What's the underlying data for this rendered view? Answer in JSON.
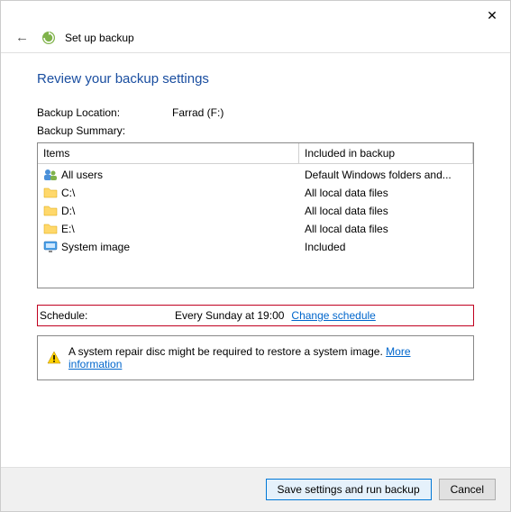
{
  "window": {
    "title": "Set up backup"
  },
  "heading": "Review your backup settings",
  "location": {
    "label": "Backup Location:",
    "value": "Farrad (F:)"
  },
  "summary_label": "Backup Summary:",
  "columns": {
    "items": "Items",
    "included": "Included in backup"
  },
  "items": [
    {
      "icon": "users",
      "name": "All users",
      "included": "Default Windows folders and..."
    },
    {
      "icon": "folder",
      "name": "C:\\",
      "included": "All local data files"
    },
    {
      "icon": "folder",
      "name": "D:\\",
      "included": "All local data files"
    },
    {
      "icon": "folder",
      "name": "E:\\",
      "included": "All local data files"
    },
    {
      "icon": "monitor",
      "name": "System image",
      "included": "Included"
    }
  ],
  "schedule": {
    "label": "Schedule:",
    "value": "Every Sunday at 19:00",
    "change_link": "Change schedule"
  },
  "notice": {
    "text": "A system repair disc might be required to restore a system image.",
    "link": "More information"
  },
  "buttons": {
    "primary": "Save settings and run backup",
    "cancel": "Cancel"
  }
}
